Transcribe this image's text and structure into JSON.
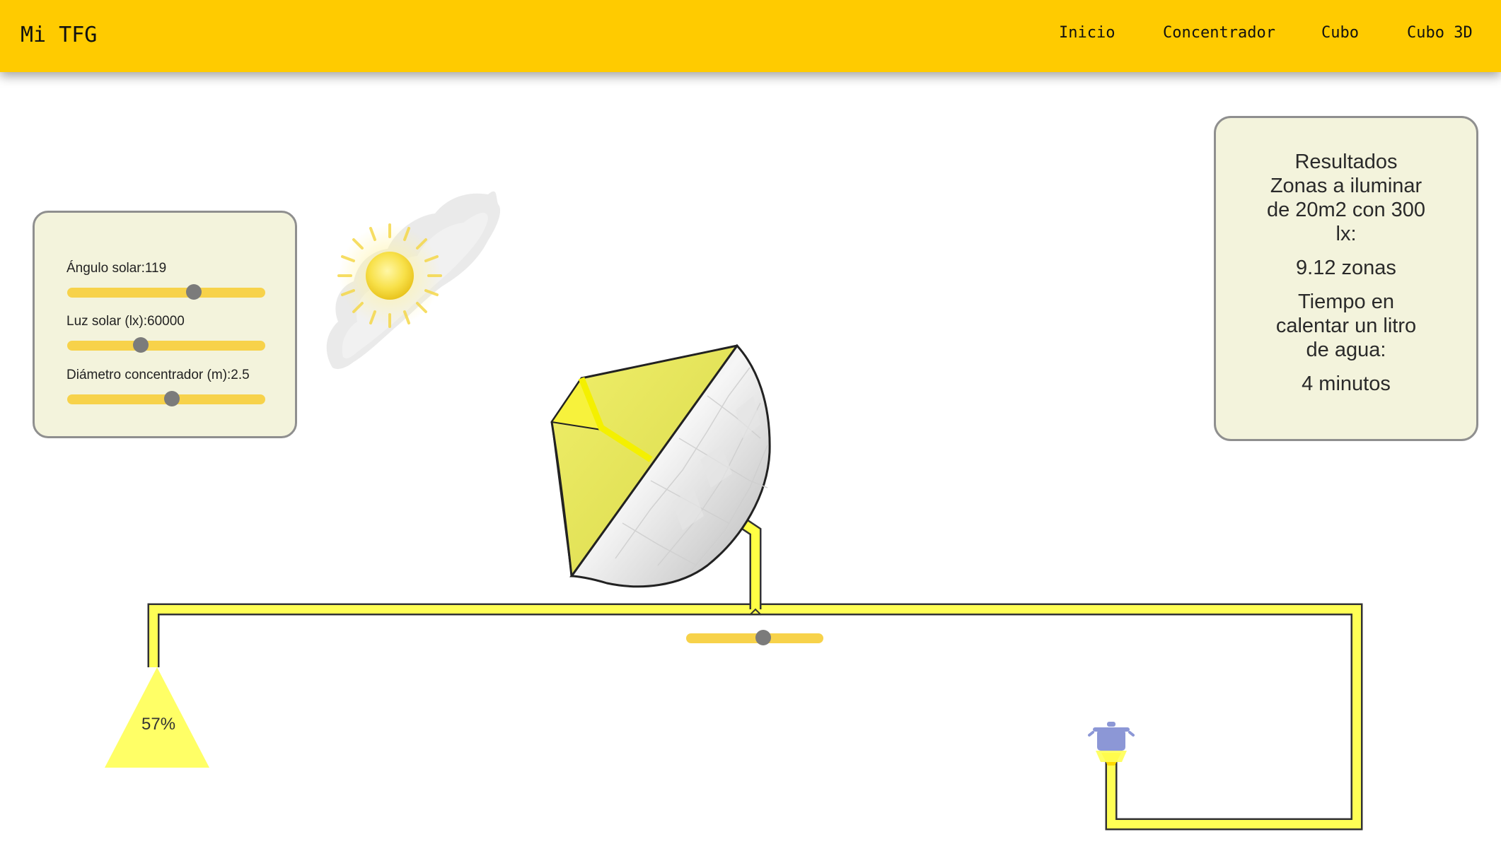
{
  "navbar": {
    "brand": "Mi TFG",
    "links": [
      "Inicio",
      "Concentrador",
      "Cubo",
      "Cubo 3D"
    ]
  },
  "controls": {
    "sun_angle_label": "Ángulo solar:119",
    "sun_angle_fraction": 0.64,
    "solar_light_label": "Luz solar (lx):60000",
    "solar_light_fraction": 0.37,
    "diameter_label": "Diámetro concentrador (m):2.5",
    "diameter_fraction": 0.53
  },
  "results": {
    "title": "Resultados",
    "zones_heading": "Zonas a iluminar de 20m2 con 300 lx:",
    "zones_value": "9.12 zonas",
    "time_heading": "Tiempo en calentar un litro de agua:",
    "time_value": "4 minutos"
  },
  "scene": {
    "lamp_percentage": "57%",
    "flow_split_fraction": 0.56,
    "colors": {
      "accent": "#ffcb00",
      "panel": "#f3f3dc",
      "pipe": "#ffff55",
      "slider": "#f7d24a",
      "pot": "#8c97d6"
    },
    "icons": [
      "sun-icon",
      "cloud-icon",
      "solar-concentrator",
      "lamp-icon",
      "cooking-pot-icon"
    ]
  }
}
